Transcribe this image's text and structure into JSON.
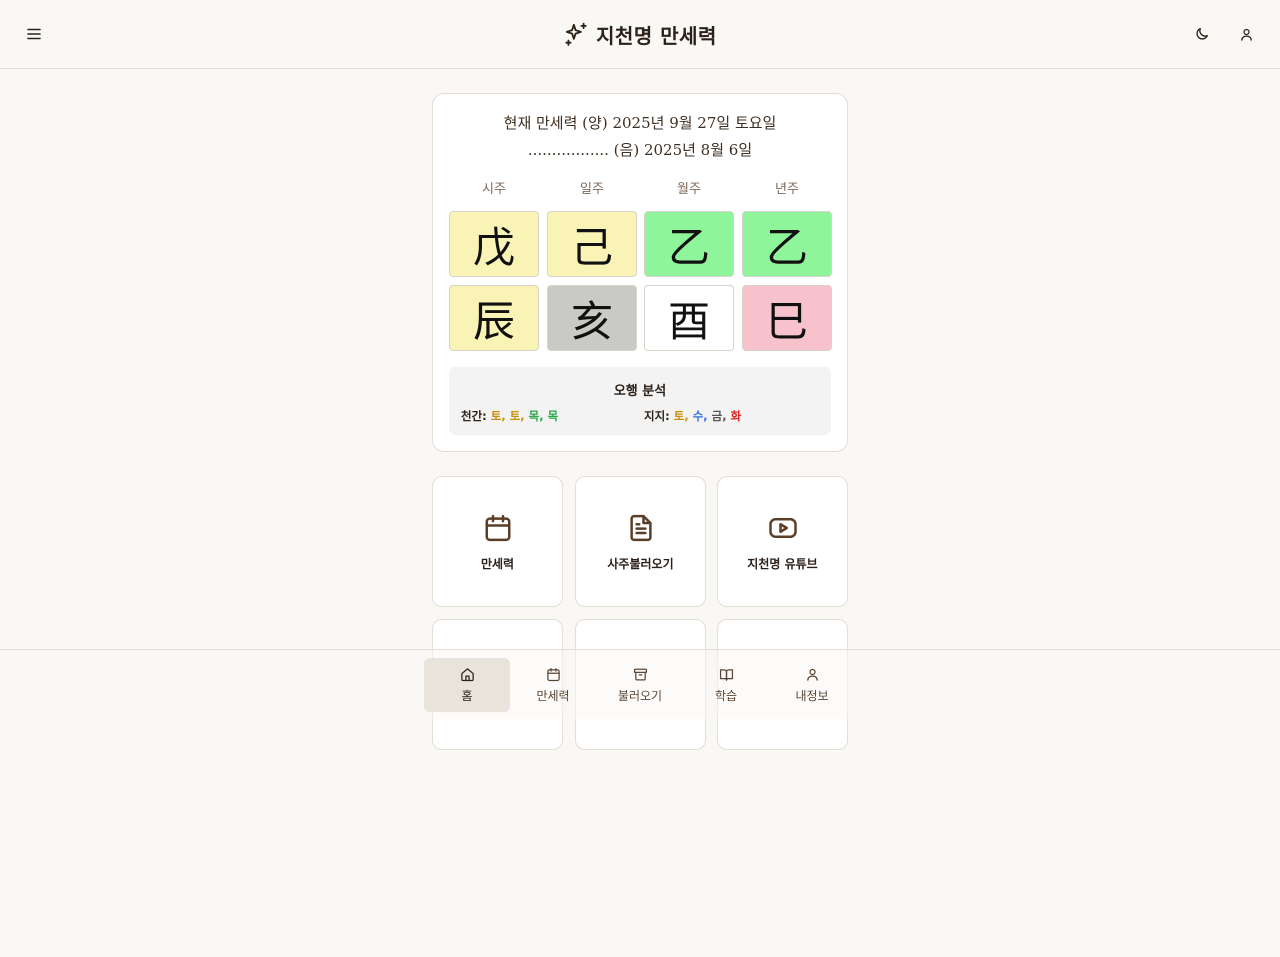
{
  "header": {
    "title": "지천명 만세력",
    "menu_icon": "menu-icon",
    "logo_icon": "sparkles-icon",
    "theme_icon": "moon-icon",
    "user_icon": "user-icon"
  },
  "calendar_card": {
    "solar_line": "현재 만세력 (양) 2025년 9월 27일 토요일",
    "lunar_line": "................. (음) 2025년 8월 6일",
    "columns": [
      {
        "label": "시주",
        "stem": "戊",
        "stem_color": "#faf3b6",
        "branch": "辰",
        "branch_color": "#faf3b6"
      },
      {
        "label": "일주",
        "stem": "己",
        "stem_color": "#faf3b6",
        "branch": "亥",
        "branch_color": "#c9c9c6"
      },
      {
        "label": "월주",
        "stem": "乙",
        "stem_color": "#8ff59b",
        "branch": "酉",
        "branch_color": "#ffffff"
      },
      {
        "label": "년주",
        "stem": "乙",
        "stem_color": "#8ff59b",
        "branch": "巳",
        "branch_color": "#f7c2cb"
      }
    ],
    "analysis": {
      "title": "오행 분석",
      "stems_label": "천간: ",
      "stems": [
        {
          "text": "토",
          "color": "#c8900d"
        },
        {
          "text": "토",
          "color": "#c8900d"
        },
        {
          "text": "목",
          "color": "#2aa84a"
        },
        {
          "text": "목",
          "color": "#2aa84a"
        }
      ],
      "branches_label": "지지: ",
      "branches": [
        {
          "text": "토",
          "color": "#c8900d"
        },
        {
          "text": "수",
          "color": "#2f6fe0"
        },
        {
          "text": "금",
          "color": "#555555"
        },
        {
          "text": "화",
          "color": "#e02424"
        }
      ]
    }
  },
  "tiles": [
    {
      "label": "만세력",
      "icon": "calendar-icon"
    },
    {
      "label": "사주불러오기",
      "icon": "document-icon"
    },
    {
      "label": "지천명 유튜브",
      "icon": "youtube-icon"
    },
    {
      "label": "",
      "icon": ""
    },
    {
      "label": "",
      "icon": ""
    },
    {
      "label": "",
      "icon": ""
    }
  ],
  "bottom_nav": {
    "active_index": 0,
    "items": [
      {
        "label": "홈",
        "icon": "home-icon"
      },
      {
        "label": "만세력",
        "icon": "calendar-icon"
      },
      {
        "label": "불러오기",
        "icon": "archive-icon"
      },
      {
        "label": "학습",
        "icon": "book-open-icon"
      },
      {
        "label": "내정보",
        "icon": "user-icon"
      }
    ]
  },
  "colors": {
    "background": "#f9f8f5",
    "accent_brown": "#5a3f28",
    "text_dark": "#2b2119"
  }
}
